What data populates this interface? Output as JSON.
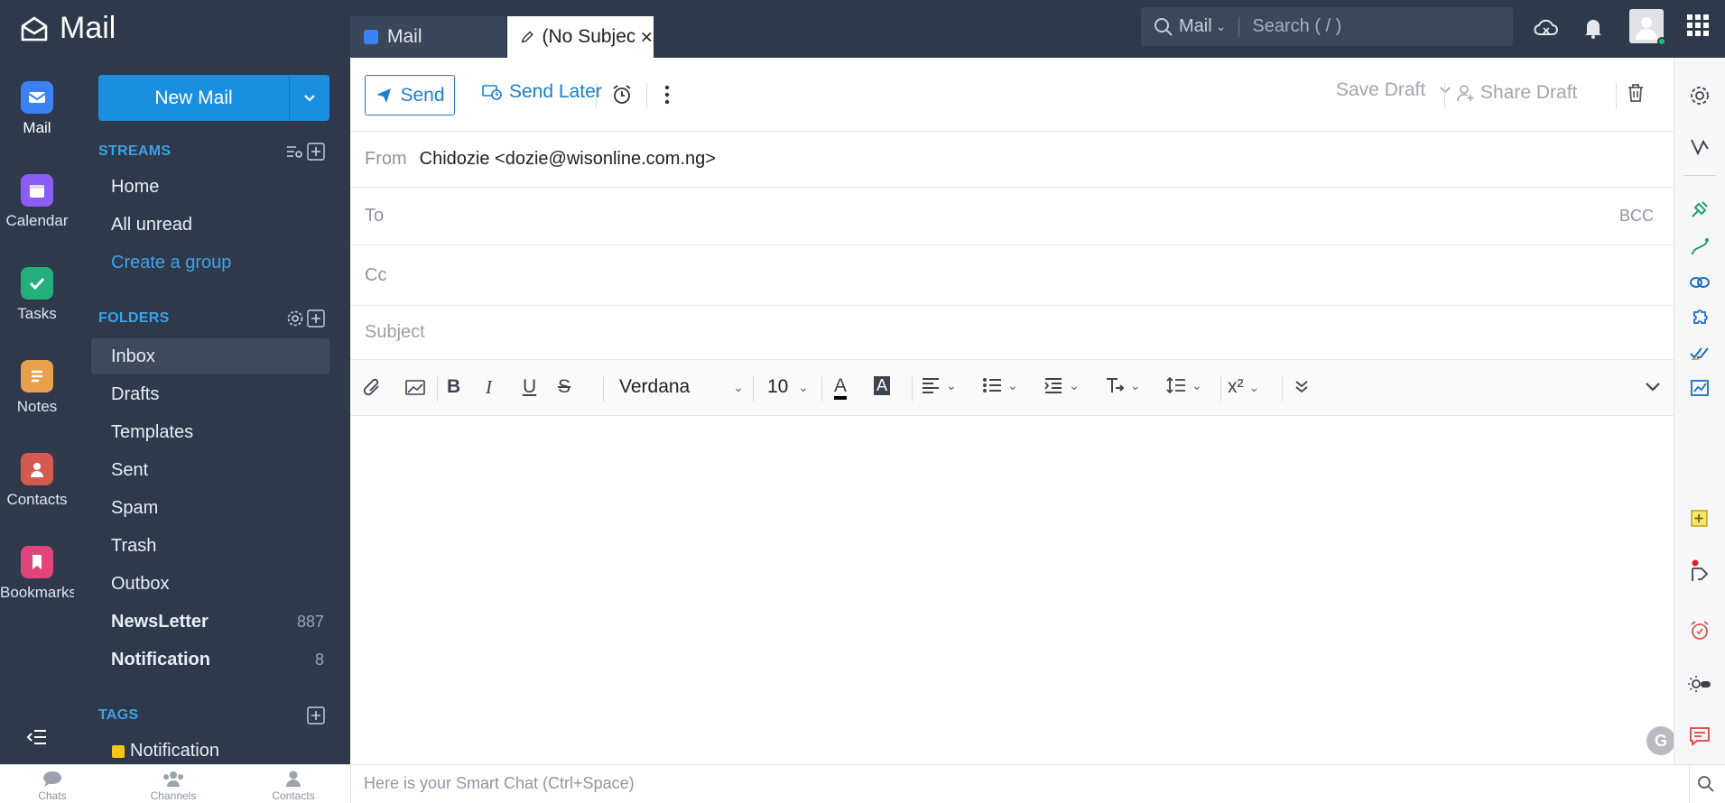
{
  "app": {
    "title": "Mail"
  },
  "tabs": [
    {
      "label": "Mail"
    },
    {
      "label": "(No Subject)"
    }
  ],
  "search": {
    "scope": "Mail",
    "placeholder": "Search ( / )"
  },
  "apps": [
    {
      "label": "Mail",
      "color": "#3b82f6"
    },
    {
      "label": "Calendar",
      "color": "#8b5cf6"
    },
    {
      "label": "Tasks",
      "color": "#22b07d"
    },
    {
      "label": "Notes",
      "color": "#e8a04a"
    },
    {
      "label": "Contacts",
      "color": "#d45a4e"
    },
    {
      "label": "Bookmarks",
      "color": "#e0457b"
    }
  ],
  "sidebar": {
    "new_mail": "New Mail",
    "streams_title": "STREAMS",
    "streams": [
      "Home",
      "All unread",
      "Create a group"
    ],
    "folders_title": "FOLDERS",
    "folders": [
      {
        "label": "Inbox",
        "count": "",
        "selected": true
      },
      {
        "label": "Drafts",
        "count": ""
      },
      {
        "label": "Templates",
        "count": ""
      },
      {
        "label": "Sent",
        "count": ""
      },
      {
        "label": "Spam",
        "count": ""
      },
      {
        "label": "Trash",
        "count": ""
      },
      {
        "label": "Outbox",
        "count": ""
      },
      {
        "label": "NewsLetter",
        "count": "887",
        "bold": true
      },
      {
        "label": "Notification",
        "count": "8",
        "bold": true
      }
    ],
    "tags_title": "TAGS",
    "tags": [
      {
        "label": "Notification",
        "color": "#f5c518"
      }
    ]
  },
  "compose": {
    "send": "Send",
    "send_later": "Send Later",
    "save_draft": "Save Draft",
    "share_draft": "Share Draft",
    "from_label": "From",
    "from_value": "Chidozie <dozie@wisonline.com.ng>",
    "to_label": "To",
    "bcc": "BCC",
    "cc_label": "Cc",
    "subject_placeholder": "Subject",
    "font": "Verdana",
    "font_size": "10"
  },
  "bottom": {
    "tabs": [
      "Chats",
      "Channels",
      "Contacts"
    ],
    "smart_chat_placeholder": "Here is your Smart Chat (Ctrl+Space)"
  }
}
